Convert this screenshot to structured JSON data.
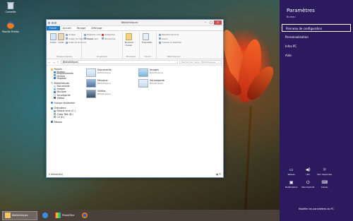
{
  "desktop": {
    "icons": [
      {
        "label": "Corbeille",
        "icon": "recycle-bin-icon"
      },
      {
        "label": "Mozilla Firefox",
        "icon": "firefox-icon"
      }
    ]
  },
  "explorer": {
    "title": "Bibliothèques",
    "tabs": [
      "Fichier",
      "Accueil",
      "Partage",
      "Affichage"
    ],
    "ribbon": {
      "groups": [
        {
          "label": "Presse-papiers",
          "buttons": [
            "Copier",
            "Coller"
          ],
          "items": [
            "Couper",
            "Copier le chemin d'accès",
            "Coller le raccourci"
          ]
        },
        {
          "label": "Organiser",
          "items": [
            "Déplacer vers",
            "Copier vers",
            "Supprimer",
            "Renommer"
          ]
        },
        {
          "label": "Nouveau",
          "buttons": [
            "Nouveau dossier"
          ]
        },
        {
          "label": "Ouvrir",
          "buttons": [
            "Propriétés"
          ]
        },
        {
          "label": "Sélectionner",
          "items": [
            "Sélectionner tout",
            "Aucun",
            "Inverser la sélection"
          ]
        }
      ]
    },
    "address": "Bibliothèques",
    "search_placeholder": "Rechercher dans : Bibliothèques",
    "nav": {
      "favoris": {
        "label": "Favoris",
        "items": [
          "Bureau",
          "Emplacements récents",
          "Dropbox"
        ]
      },
      "bibliotheques": {
        "label": "Bibliothèques",
        "items": [
          "Documents",
          "Images",
          "Musique",
          "Sauvegarde",
          "Vidéos"
        ]
      },
      "groupe": "Groupe résidentiel",
      "ordinateur": {
        "label": "Ordinateur",
        "items": [
          "Disque local (C:)",
          "Clubs Test (D:)",
          "CS (E:)"
        ]
      },
      "reseau": "Réseau"
    },
    "libraries": [
      {
        "name": "Documents",
        "type": "Bibliothèque"
      },
      {
        "name": "Images",
        "type": "Bibliothèque"
      },
      {
        "name": "Musique",
        "type": "Bibliothèque"
      },
      {
        "name": "Sauvegarde",
        "type": "Bibliothèque"
      },
      {
        "name": "Vidéos",
        "type": "Bibliothèque"
      }
    ],
    "status": "5 élément(s)"
  },
  "settings_panel": {
    "title": "Paramètres",
    "subtitle": "Bureau",
    "links": [
      "Panneau de configuration",
      "Personnalisation",
      "Infos PC",
      "Aide"
    ],
    "selected_index": 0,
    "tiles": [
      {
        "label": "Réseau",
        "icon": "network-icon",
        "glyph": "▭"
      },
      {
        "label": "(40)",
        "icon": "volume-icon",
        "glyph": "◀)"
      },
      {
        "label": "Non disponible",
        "icon": "brightness-icon",
        "glyph": "☼"
      },
      {
        "label": "",
        "icon": "empty-tile",
        "glyph": ""
      },
      {
        "label": "Notifications",
        "icon": "notifications-icon",
        "glyph": "▣"
      },
      {
        "label": "Marche/Arrêt",
        "icon": "power-icon",
        "glyph": "⏻"
      },
      {
        "label": "Clavier",
        "icon": "keyboard-icon",
        "glyph": "⌨"
      },
      {
        "label": "",
        "icon": "empty-tile",
        "glyph": ""
      }
    ],
    "footer": "Modifier les paramètres du PC"
  },
  "taskbar": {
    "items": [
      {
        "label": "Bibliothèques",
        "icon": "folder-icon",
        "active": true
      },
      {
        "label": "",
        "icon": "ie-icon",
        "active": false
      },
      {
        "label": "PhotoFiltre",
        "icon": "photofiltre-icon",
        "active": false
      },
      {
        "label": "",
        "icon": "firefox-icon",
        "active": false
      }
    ]
  },
  "colors": {
    "panel_bg": "#2b1a5e",
    "file_tab": "#1979ca"
  }
}
